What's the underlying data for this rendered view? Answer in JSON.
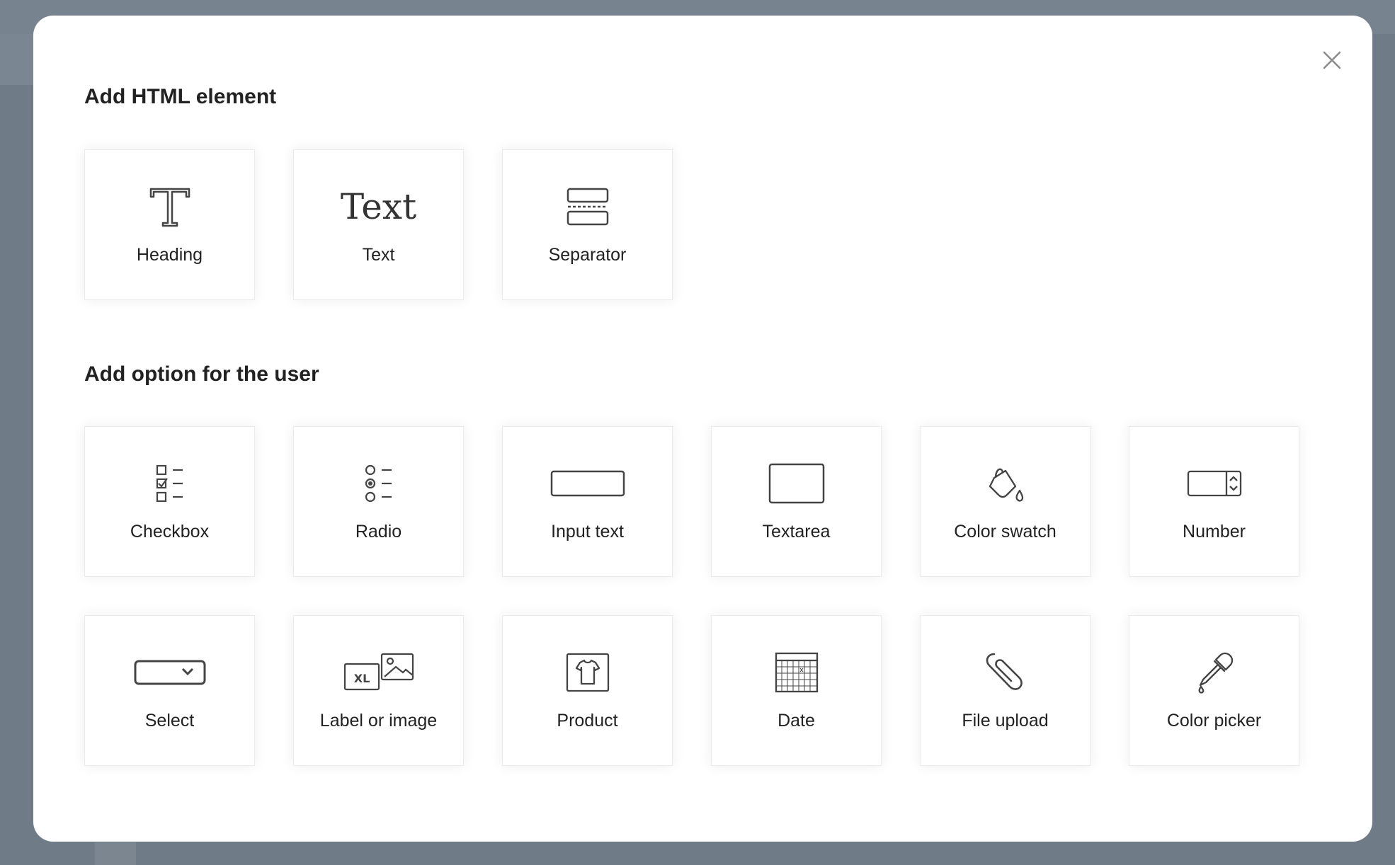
{
  "dialog": {
    "close_icon": "close-icon"
  },
  "sections": {
    "html_elements": {
      "title": "Add HTML element",
      "items": [
        {
          "label": "Heading",
          "icon": "heading-icon"
        },
        {
          "label": "Text",
          "icon": "text-icon",
          "glyph": "Text"
        },
        {
          "label": "Separator",
          "icon": "separator-icon"
        }
      ]
    },
    "user_options": {
      "title": "Add option for the user",
      "items": [
        {
          "label": "Checkbox",
          "icon": "checkbox-icon"
        },
        {
          "label": "Radio",
          "icon": "radio-icon"
        },
        {
          "label": "Input text",
          "icon": "input-text-icon"
        },
        {
          "label": "Textarea",
          "icon": "textarea-icon"
        },
        {
          "label": "Color swatch",
          "icon": "color-swatch-icon"
        },
        {
          "label": "Number",
          "icon": "number-icon"
        },
        {
          "label": "Select",
          "icon": "select-icon"
        },
        {
          "label": "Label or image",
          "icon": "label-or-image-icon",
          "badge": "XL"
        },
        {
          "label": "Product",
          "icon": "product-icon"
        },
        {
          "label": "Date",
          "icon": "date-icon"
        },
        {
          "label": "File upload",
          "icon": "file-upload-icon"
        },
        {
          "label": "Color picker",
          "icon": "color-picker-icon"
        }
      ]
    }
  }
}
